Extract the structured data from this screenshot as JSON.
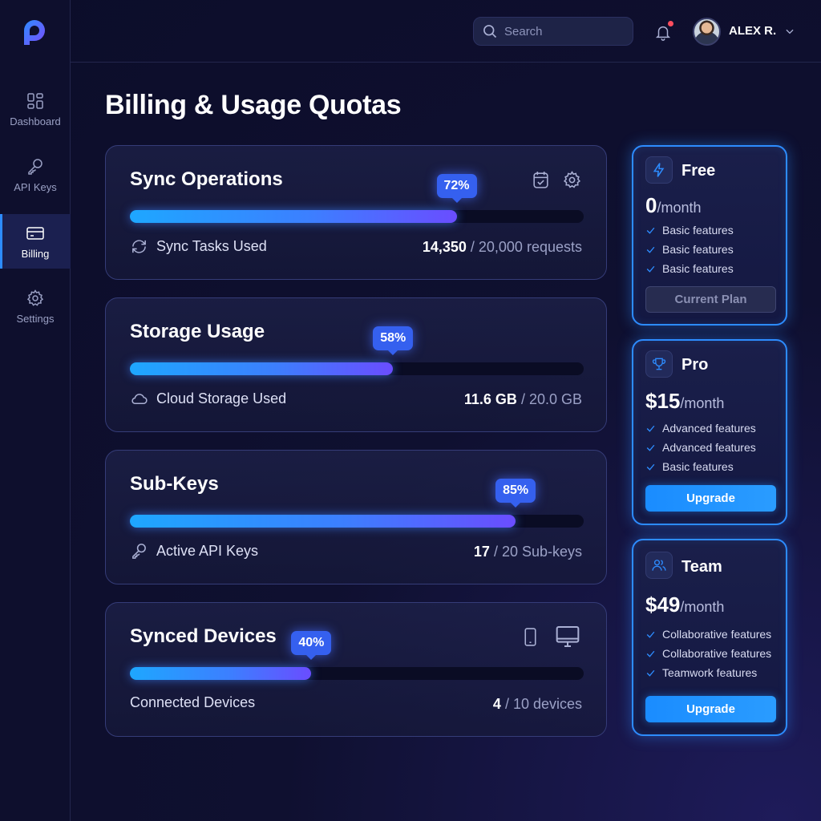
{
  "sidebar": {
    "items": [
      {
        "label": "Dashboard",
        "icon": "dashboard-icon"
      },
      {
        "label": "API Keys",
        "icon": "key-icon"
      },
      {
        "label": "Billing",
        "icon": "credit-card-icon",
        "active": true
      },
      {
        "label": "Settings",
        "icon": "gear-icon"
      }
    ]
  },
  "header": {
    "search_placeholder": "Search",
    "username": "ALEX R.",
    "notification_dot": true
  },
  "page": {
    "title": "Billing & Usage Quotas"
  },
  "usage": [
    {
      "title": "Sync Operations",
      "percent": 72,
      "percent_label": "72%",
      "meta_label": "Sync Tasks Used",
      "meta_icon": "sync-icon",
      "used": "14,350",
      "limit": "/ 20,000 requests",
      "header_icons": [
        "calendar-check-icon",
        "gear-icon"
      ]
    },
    {
      "title": "Storage Usage",
      "percent": 58,
      "percent_label": "58%",
      "meta_label": "Cloud Storage Used",
      "meta_icon": "cloud-icon",
      "used": "11.6 GB",
      "limit": "/ 20.0 GB"
    },
    {
      "title": "Sub-Keys",
      "percent": 85,
      "percent_label": "85%",
      "meta_label": "Active API Keys",
      "meta_icon": "key-icon",
      "used": "17",
      "limit": "/ 20 Sub-keys"
    },
    {
      "title": "Synced Devices",
      "percent": 40,
      "percent_label": "40%",
      "meta_label": "Connected Devices",
      "used": "4",
      "limit": "/ 10 devices",
      "header_icons": [
        "phone-icon",
        "monitor-icon"
      ]
    }
  ],
  "plans": [
    {
      "name": "Free",
      "icon": "lightning-icon",
      "price": "0",
      "period": "/month",
      "features": [
        "Basic features",
        "Basic features",
        "Basic features"
      ],
      "button": "Current Plan"
    },
    {
      "name": "Pro",
      "icon": "trophy-icon",
      "price": "$15",
      "period": "/month",
      "features": [
        "Advanced features",
        "Advanced features",
        "Basic features"
      ],
      "button": "Upgrade"
    },
    {
      "name": "Team",
      "icon": "users-icon",
      "price": "$49",
      "period": "/month",
      "features": [
        "Collaborative features",
        "Collaborative features",
        "Teamwork features"
      ],
      "button": "Upgrade"
    }
  ],
  "colors": {
    "accent": "#2d8cff",
    "badge": "#3560ef",
    "background": "#0f1030"
  }
}
